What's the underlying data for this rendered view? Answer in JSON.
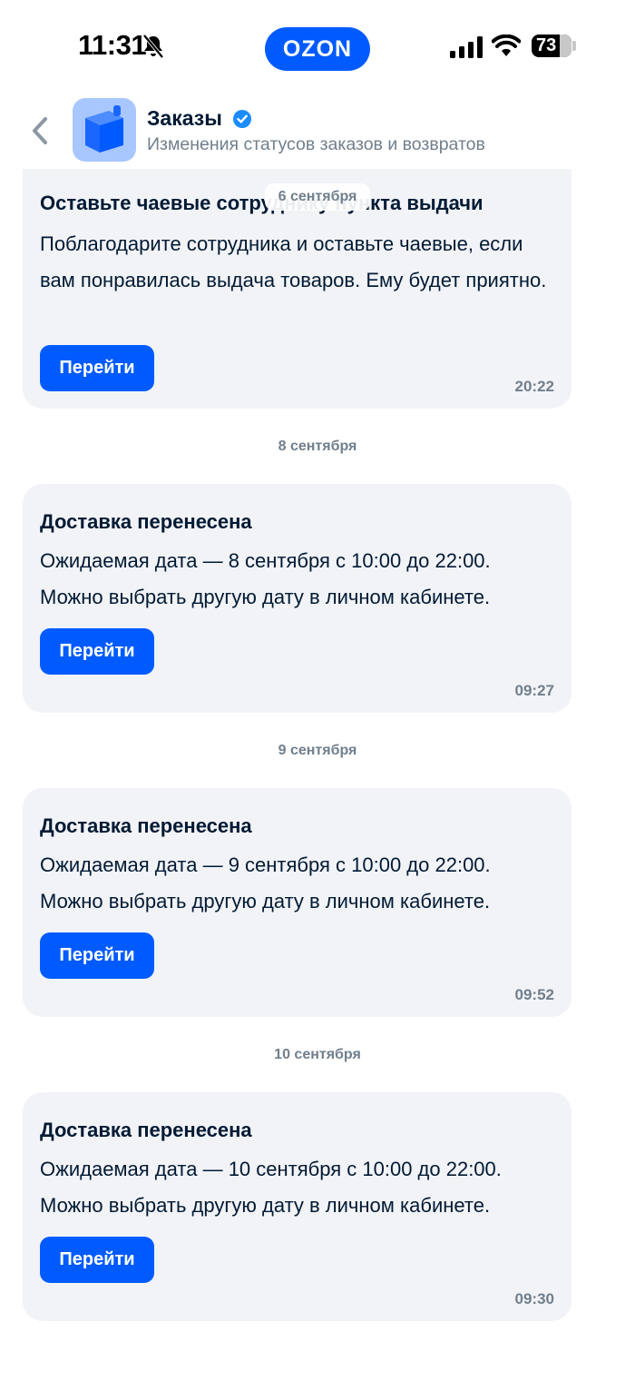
{
  "status_bar": {
    "time": "11:31",
    "brand": "OZON",
    "battery": "73"
  },
  "header": {
    "title": "Заказы",
    "subtitle": "Изменения статусов заказов и возвратов"
  },
  "floating_date": "6 сентября",
  "messages": [
    {
      "title": "Оставьте чаевые сотруднику пункта выдачи",
      "text": "Поблагодарите сотрудника и оставьте чаевые, если вам понравилась выдача товаров. Ему будет приятно.",
      "button": "Перейти",
      "time": "20:22"
    },
    {
      "date": "8 сентября",
      "title": "Доставка перенесена",
      "text": "Ожидаемая дата — 8 сентября с 10:00 до 22:00. Можно выбрать другую дату в личном кабинете.",
      "button": "Перейти",
      "time": "09:27"
    },
    {
      "date": "9 сентября",
      "title": "Доставка перенесена",
      "text": "Ожидаемая дата — 9 сентября с 10:00 до 22:00. Можно выбрать другую дату в личном кабинете.",
      "button": "Перейти",
      "time": "09:52"
    },
    {
      "date": "10 сентября",
      "title": "Доставка перенесена",
      "text": "Ожидаемая дата — 10 сентября с 10:00 до 22:00. Можно выбрать другую дату в личном кабинете.",
      "button": "Перейти",
      "time": "09:30"
    }
  ],
  "colors": {
    "accent": "#005bff",
    "card_bg": "#f2f3f7",
    "muted": "#707f8d",
    "verified": "#1a8cff"
  }
}
